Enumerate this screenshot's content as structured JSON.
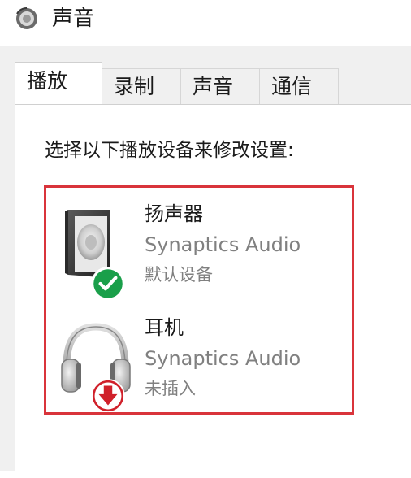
{
  "window": {
    "title": "声音",
    "icon": "speaker-icon"
  },
  "tabs": [
    {
      "label": "播放",
      "active": true
    },
    {
      "label": "录制",
      "active": false
    },
    {
      "label": "声音",
      "active": false
    },
    {
      "label": "通信",
      "active": false
    }
  ],
  "panel": {
    "instruction": "选择以下播放设备来修改设置:"
  },
  "devices": [
    {
      "name": "扬声器",
      "driver": "Synaptics Audio",
      "status": "默认设备",
      "icon": "speaker-device-icon",
      "badge": "default-check-icon",
      "badge_color": "#1a9f4a"
    },
    {
      "name": "耳机",
      "driver": "Synaptics Audio",
      "status": "未插入",
      "icon": "headphones-device-icon",
      "badge": "unplugged-arrow-icon",
      "badge_color": "#d0202a"
    }
  ],
  "colors": {
    "highlight_border": "#d9343b",
    "dialog_bg": "#f0f0f0"
  }
}
